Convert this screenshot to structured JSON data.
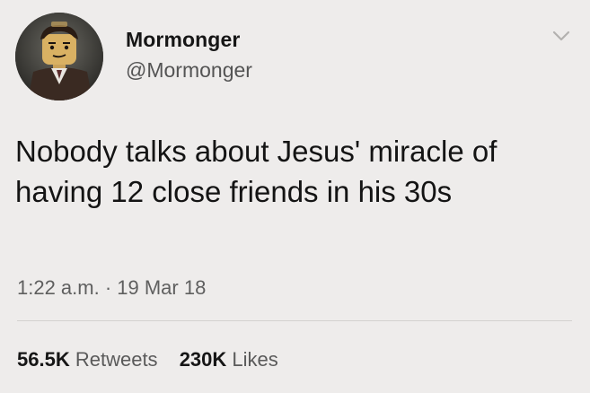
{
  "author": {
    "display_name": "Mormonger",
    "handle": "@Mormonger",
    "avatar_icon": "lego-minifigure-avatar"
  },
  "menu": {
    "icon": "chevron-down-icon"
  },
  "tweet": {
    "text": "Nobody talks about Jesus' miracle of having 12 close friends in his 30s",
    "timestamp": "1:22 a.m. · 19 Mar 18"
  },
  "stats": {
    "retweets_count": "56.5K",
    "retweets_label": "Retweets",
    "likes_count": "230K",
    "likes_label": "Likes"
  },
  "colors": {
    "background": "#eeeceb",
    "text_primary": "#141414",
    "text_secondary": "#5f5f5f",
    "divider": "#d3d1cf"
  }
}
